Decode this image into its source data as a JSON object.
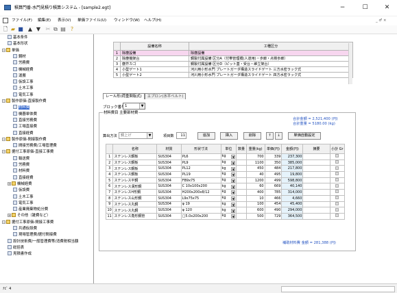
{
  "window": {
    "title": "積算門番-水門見積り積算システム - [sample2.egt]",
    "minimize": "−",
    "maximize": "☐",
    "close": "✕",
    "inner_controls": "_ ♂ ×"
  },
  "menu": [
    "ファイル(F)",
    "編集(E)",
    "表示(V)",
    "単価ファイル(U)",
    "ウィンドウ(W)",
    "ヘルプ(H)"
  ],
  "toolbar": [
    "new-icon",
    "open-icon",
    "save-icon",
    "up-icon",
    "down-icon",
    "cut-icon",
    "copy-icon",
    "paste-icon",
    "help-icon"
  ],
  "tree": [
    {
      "label": "基本条件",
      "indent": 1,
      "type": "doc"
    },
    {
      "label": "基本形状",
      "indent": 1,
      "type": "doc"
    },
    {
      "label": "単価",
      "indent": 0,
      "type": "folder",
      "expander": "−"
    },
    {
      "label": "鋼材",
      "indent": 2,
      "type": "doc"
    },
    {
      "label": "労務費",
      "indent": 2,
      "type": "doc"
    },
    {
      "label": "機械経費",
      "indent": 2,
      "type": "doc"
    },
    {
      "label": "運搬",
      "indent": 2,
      "type": "doc"
    },
    {
      "label": "仮設工事",
      "indent": 2,
      "type": "doc"
    },
    {
      "label": "土木工事",
      "indent": 2,
      "type": "doc"
    },
    {
      "label": "電気工事",
      "indent": 2,
      "type": "doc"
    },
    {
      "label": "製作原価-直接製作費",
      "indent": 0,
      "type": "folder",
      "expander": "−"
    },
    {
      "label": "材料費",
      "indent": 2,
      "type": "doc",
      "selected": true
    },
    {
      "label": "機器単体費",
      "indent": 2,
      "type": "doc"
    },
    {
      "label": "直接労務費",
      "indent": 2,
      "type": "doc"
    },
    {
      "label": "工場直接費",
      "indent": 2,
      "type": "doc"
    },
    {
      "label": "直接経費",
      "indent": 2,
      "type": "doc"
    },
    {
      "label": "製作原価-間接製作費",
      "indent": 0,
      "type": "folder",
      "expander": "−"
    },
    {
      "label": "間接労務費/工場管理費",
      "indent": 2,
      "type": "doc"
    },
    {
      "label": "据付工事原価-直接工事費",
      "indent": 0,
      "type": "folder",
      "expander": "−"
    },
    {
      "label": "輸送費",
      "indent": 2,
      "type": "doc"
    },
    {
      "label": "労務費",
      "indent": 2,
      "type": "doc"
    },
    {
      "label": "材料費",
      "indent": 2,
      "type": "doc"
    },
    {
      "label": "直接経費",
      "indent": 2,
      "type": "doc"
    },
    {
      "label": "機械経費",
      "indent": 1,
      "type": "folder",
      "expander": "+"
    },
    {
      "label": "仮設費",
      "indent": 2,
      "type": "doc"
    },
    {
      "label": "土木工事",
      "indent": 2,
      "type": "doc"
    },
    {
      "label": "電気工事",
      "indent": 2,
      "type": "doc"
    },
    {
      "label": "産業廃棄物処分費",
      "indent": 2,
      "type": "doc"
    },
    {
      "label": "その他（雑費など）",
      "indent": 1,
      "type": "folder",
      "expander": "+"
    },
    {
      "label": "据付工事原価-間接工事費",
      "indent": 0,
      "type": "folder",
      "expander": "−"
    },
    {
      "label": "共通仮設費",
      "indent": 2,
      "type": "doc"
    },
    {
      "label": "現場管理費/据付間接費",
      "indent": 2,
      "type": "doc"
    },
    {
      "label": "設計技術費/一般管理費等/消費税相当額",
      "indent": 1,
      "type": "doc"
    },
    {
      "label": "総括表",
      "indent": 1,
      "type": "doc"
    },
    {
      "label": "見積書作成",
      "indent": 1,
      "type": "doc"
    }
  ],
  "equipment_table": {
    "headers": [
      "",
      "設備名称",
      "工種区分"
    ],
    "rows": [
      {
        "no": "1",
        "name": "除塵設備",
        "type": "除塵設備",
        "highlight": true
      },
      {
        "no": "2",
        "name": "除塵機架台",
        "type": "鋼製付属設備 区分A（付帯管理橋(人道用)・歩廊・点検歩廊）",
        "highlight": false
      },
      {
        "no": "3",
        "name": "塵芥カゴ",
        "type": "鋼製付属設備 区分D（ピット蓋・受台・維立架台）",
        "highlight": false
      },
      {
        "no": "4",
        "name": "小型ゲート1",
        "type": "河川用小形水門 プレートガーダ構造スライドゲート 三方水密ラック式",
        "highlight": false
      },
      {
        "no": "5",
        "name": "小型ゲート2",
        "type": "河川用小形水門 プレートガーダ構造スライドゲート 四方水密ラック式",
        "highlight": false
      }
    ]
  },
  "tabs": {
    "active": "レール形(荷重関転式)",
    "inactive": "エプロン(水平ベルト)"
  },
  "block": {
    "label": "ブロック番号",
    "value": "1"
  },
  "group": {
    "label": "材料費目 主要部材費"
  },
  "totals": {
    "grand": "合計金額 = 2,521,400 (円)",
    "weight": "合計重量 = 5180.00 (kg)"
  },
  "controls": {
    "calc_label": "算出方法",
    "calc_value": "鋼上げ",
    "item_count_label": "項目数",
    "item_count": "11",
    "add": "追加",
    "insert": "挿入",
    "delete": "削除",
    "up": "↑",
    "down": "↓",
    "unit_set": "単価自動設定"
  },
  "material_table": {
    "headers": [
      "",
      "名称",
      "材質",
      "形状寸法",
      "単位",
      "数量",
      "重量(kg)",
      "単価(円)",
      "金額(円)",
      "摘要",
      "小計 Gr"
    ],
    "rows": [
      [
        "1",
        "ステンレス鋼板",
        "SUS304",
        "PL6",
        "kg",
        "",
        "700",
        "339",
        "237,300",
        ""
      ],
      [
        "2",
        "ステンレス鋼板",
        "SUS304",
        "PL9",
        "kg",
        "",
        "1100",
        "350",
        "385,000",
        ""
      ],
      [
        "3",
        "ステンレス鋼板",
        "SUS304",
        "PL12",
        "kg",
        "",
        "450",
        "484",
        "217,800",
        ""
      ],
      [
        "4",
        "ステンレス鋼板",
        "SUS304",
        "PL19",
        "kg",
        "",
        "40",
        "495",
        "19,800",
        ""
      ],
      [
        "5",
        "ステンレス平鋼",
        "SUS304",
        "FB9x75",
        "kg",
        "",
        "1200",
        "499",
        "598,800",
        ""
      ],
      [
        "6",
        "ステンレス溝形鋼",
        "SUS304",
        "C 10x100x200",
        "kg",
        "",
        "60",
        "669",
        "40,140",
        ""
      ],
      [
        "7",
        "ステンレスH形鋼",
        "SUS304",
        "H200x200x8/12",
        "kg",
        "",
        "400",
        "785",
        "314,000",
        ""
      ],
      [
        "8",
        "ステンレス山形鋼",
        "SUS304",
        "L9x75x75",
        "kg",
        "",
        "10",
        "466",
        "4,660",
        ""
      ],
      [
        "9",
        "ステンレス丸鋼",
        "SUS304",
        "φ 19",
        "kg",
        "",
        "100",
        "454",
        "45,400",
        ""
      ],
      [
        "10",
        "ステンレス丸鋼",
        "SUS304",
        "φ 120",
        "kg",
        "",
        "600",
        "490",
        "294,000",
        ""
      ],
      [
        "11",
        "ステンレス角形鋼管",
        "SUS304",
        "□5.0x200x200",
        "kg",
        "",
        "500",
        "729",
        "364,500",
        ""
      ]
    ]
  },
  "subtotal": "補助材料費 金額 = 281,388 (円)",
  "status": {
    "left": "ﾅﾋﾞ 4"
  }
}
